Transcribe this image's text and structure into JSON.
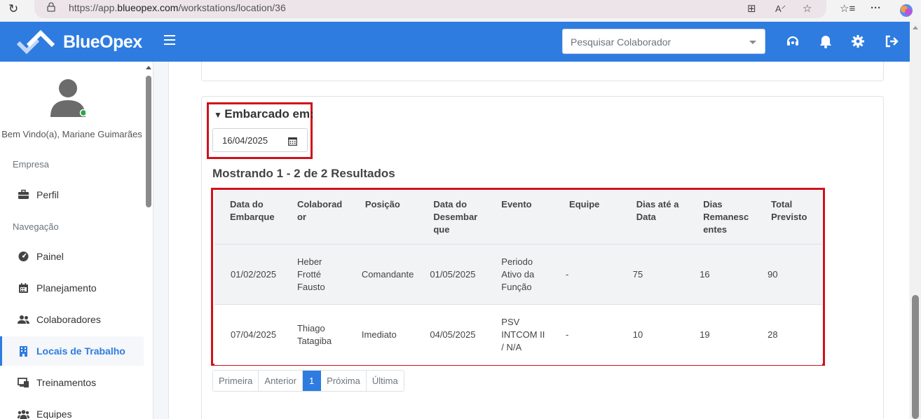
{
  "browser": {
    "url_prefix": "https://app.",
    "url_domain": "blueopex.com",
    "url_path": "/workstations/location/36"
  },
  "header": {
    "brand": "BlueOpex",
    "search_placeholder": "Pesquisar Colaborador",
    "accent_color": "#2e7ce0"
  },
  "sidebar": {
    "welcome": "Bem Vindo(a), Mariane Guimarães",
    "section_empresa": "Empresa",
    "section_navegacao": "Navegação",
    "items": [
      {
        "label": "Perfil",
        "icon": "briefcase-icon"
      },
      {
        "label": "Painel",
        "icon": "dashboard-icon"
      },
      {
        "label": "Planejamento",
        "icon": "calendar-icon"
      },
      {
        "label": "Colaboradores",
        "icon": "users-icon"
      },
      {
        "label": "Locais de Trabalho",
        "icon": "building-icon",
        "active": true
      },
      {
        "label": "Treinamentos",
        "icon": "training-icon"
      },
      {
        "label": "Equipes",
        "icon": "team-icon"
      }
    ]
  },
  "filter": {
    "title": "Embarcado em:",
    "date_value": "16/04/2025"
  },
  "results": {
    "summary": "Mostrando 1 - 2 de 2 Resultados"
  },
  "table": {
    "headers": [
      [
        "Data do",
        "Embarque"
      ],
      [
        "Colaborad",
        "or"
      ],
      [
        "Posição"
      ],
      [
        "Data do",
        "Desembar",
        "que"
      ],
      [
        "Evento"
      ],
      [
        "Equipe"
      ],
      [
        "Dias até a",
        "Data"
      ],
      [
        "Dias",
        "Remanesc",
        "entes"
      ],
      [
        "Total",
        "Previsto"
      ]
    ],
    "rows": [
      [
        [
          "01/02/2025"
        ],
        [
          "Heber",
          "Frotté",
          "Fausto"
        ],
        [
          "Comandante"
        ],
        [
          "01/05/2025"
        ],
        [
          "Periodo",
          "Ativo da",
          "Função"
        ],
        [
          "-"
        ],
        [
          "75"
        ],
        [
          "16"
        ],
        [
          "90"
        ]
      ],
      [
        [
          "07/04/2025"
        ],
        [
          "Thiago",
          "Tatagiba"
        ],
        [
          "Imediato"
        ],
        [
          "04/05/2025"
        ],
        [
          "PSV",
          "INTCOM II",
          "/ N/A"
        ],
        [
          "-"
        ],
        [
          "10"
        ],
        [
          "19"
        ],
        [
          "28"
        ]
      ]
    ]
  },
  "pagination": {
    "first": "Primeira",
    "prev": "Anterior",
    "current": "1",
    "next": "Próxima",
    "last": "Última"
  }
}
